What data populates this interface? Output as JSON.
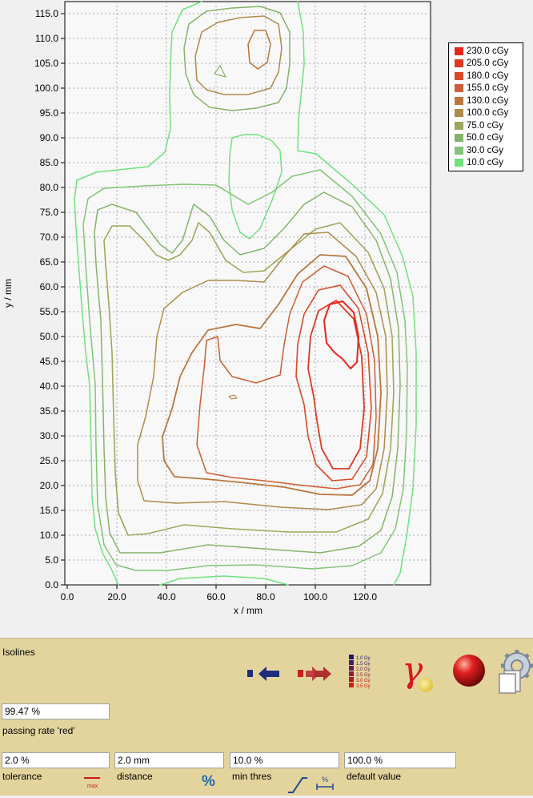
{
  "chart_data": {
    "type": "contour",
    "xlabel": "x / mm",
    "ylabel": "y / mm",
    "xlim": [
      0,
      135
    ],
    "ylim": [
      0,
      117
    ],
    "x_ticks": [
      "0.0",
      "20.0",
      "40.0",
      "60.0",
      "80.0",
      "100.0",
      "120.0"
    ],
    "y_ticks": [
      "0.0",
      "5.0",
      "10.0",
      "15.0",
      "20.0",
      "25.0",
      "30.0",
      "35.0",
      "40.0",
      "45.0",
      "50.0",
      "55.0",
      "60.0",
      "65.0",
      "70.0",
      "75.0",
      "80.0",
      "85.0",
      "90.0",
      "95.0",
      "100.0",
      "105.0",
      "110.0",
      "115.0"
    ],
    "grid": true,
    "legend_position": "top-right",
    "series": [
      {
        "name": "230.0 cGy",
        "color": "#e8261b"
      },
      {
        "name": "205.0 cGy",
        "color": "#dd3a22"
      },
      {
        "name": "180.0 cGy",
        "color": "#d64a28"
      },
      {
        "name": "155.0 cGy",
        "color": "#cc5e34"
      },
      {
        "name": "130.0 cGy",
        "color": "#b9763e"
      },
      {
        "name": "100.0 cGy",
        "color": "#ad8c4a"
      },
      {
        "name": "75.0 cGy",
        "color": "#9ea85a"
      },
      {
        "name": "50.0 cGy",
        "color": "#86b36a"
      },
      {
        "name": "30.0 cGy",
        "color": "#82c477"
      },
      {
        "name": "10.0 cGy",
        "color": "#6fe27d"
      }
    ]
  },
  "panel": {
    "title": "Isolines",
    "passing_rate_value": "99.47 %",
    "passing_rate_label": "passing rate 'red'",
    "tolerance_value": "2.0 %",
    "tolerance_label": "tolerance",
    "distance_value": "2.0 mm",
    "distance_label": "distance",
    "min_thres_value": "10.0 %",
    "min_thres_label": "min thres",
    "default_value_value": "100.0 %",
    "default_value_label": "default value",
    "percent_button": "%",
    "max_icon_text": "max",
    "gamma_symbol": "γ",
    "legend_icon_labels": [
      "1.0 Gy",
      "1.5 Gy",
      "2.0 Gy",
      "2.5 Gy",
      "3.0 Gy",
      "3.5 Gy"
    ],
    "slope_icon_text": "%"
  }
}
